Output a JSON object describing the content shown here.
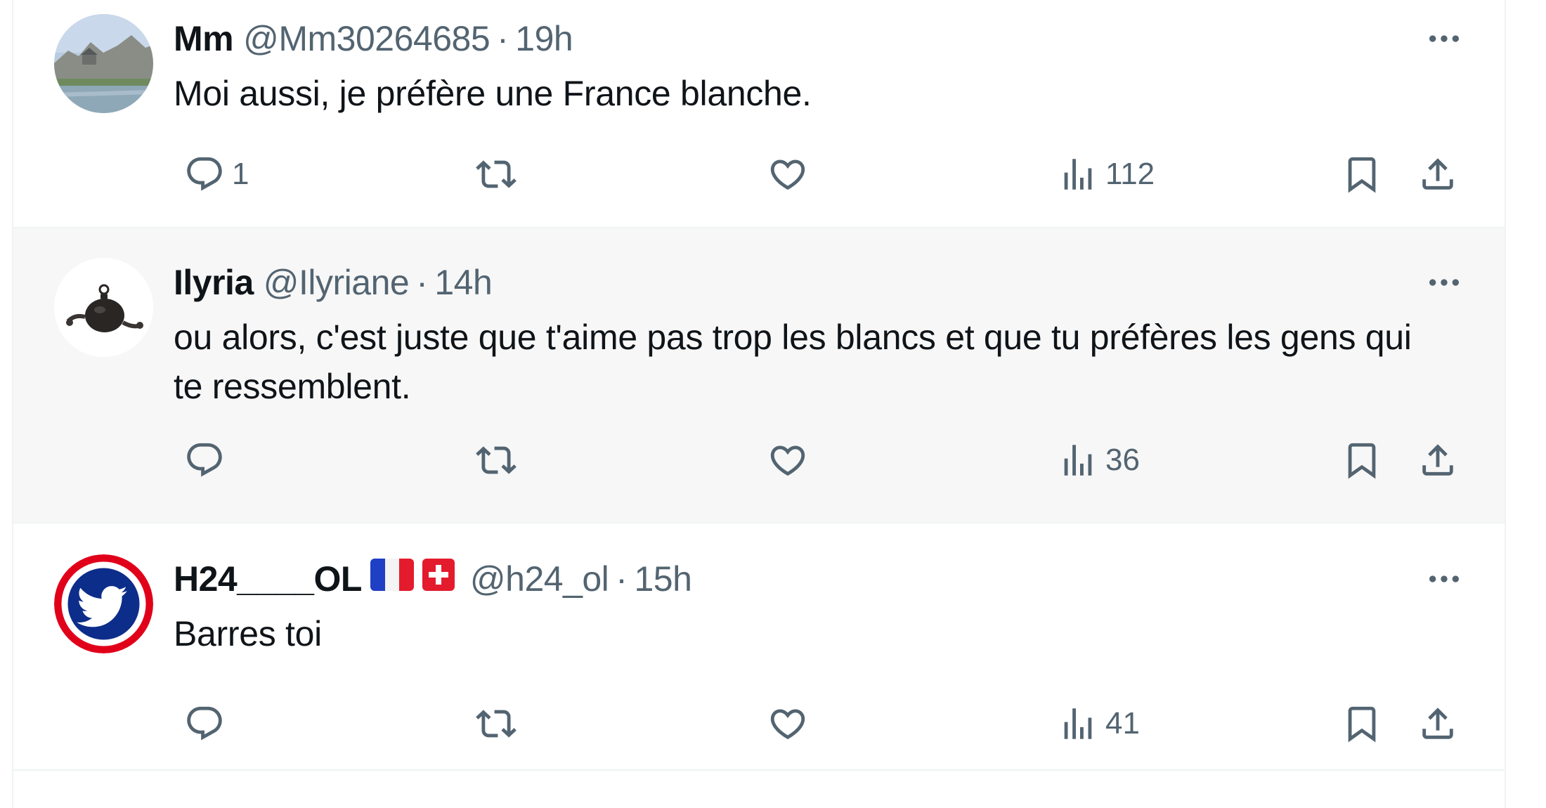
{
  "colors": {
    "text_primary": "#0f1419",
    "text_secondary": "#536471",
    "divider": "#eff3f4",
    "highlight_row": "#f7f7f7"
  },
  "tweets": [
    {
      "display_name": "Mm",
      "handle": "@Mm30264685",
      "separator": "·",
      "time": "19h",
      "text": "Moi aussi, je préfère une France blanche.",
      "avatar": "coastal-house-photo",
      "reply_count": "1",
      "repost_count": "",
      "like_count": "",
      "view_count": "112"
    },
    {
      "display_name": "Ilyria",
      "handle": "@Ilyriane",
      "separator": "·",
      "time": "14h",
      "text": "ou alors, c'est juste que t'aime pas trop les blancs et que tu préfères les gens qui te ressemblent.",
      "avatar": "ball-and-chain-image",
      "reply_count": "",
      "repost_count": "",
      "like_count": "",
      "view_count": "36"
    },
    {
      "display_name": "H24____OL",
      "handle": "@h24_ol",
      "separator": "·",
      "time": "15h",
      "text": "Barres toi",
      "avatar": "tricolor-bird-logo",
      "flags": [
        "french-flag",
        "swiss-flag"
      ],
      "reply_count": "",
      "repost_count": "",
      "like_count": "",
      "view_count": "41"
    }
  ],
  "icons": {
    "reply": "reply-icon",
    "repost": "repost-icon",
    "like": "heart-icon",
    "views": "views-icon",
    "bookmark": "bookmark-icon",
    "share": "share-icon",
    "more": "more-icon"
  }
}
